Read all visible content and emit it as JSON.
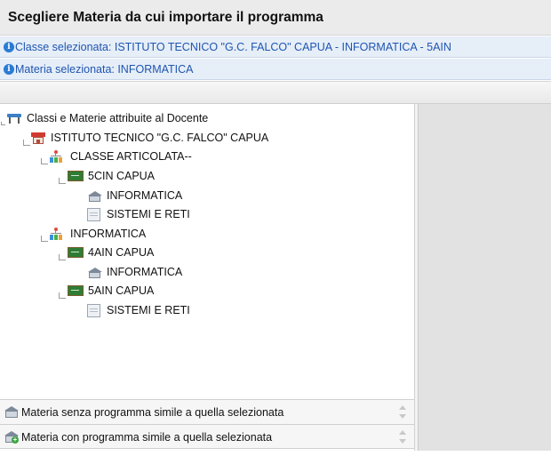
{
  "header": {
    "title": "Scegliere Materia da cui importare il programma"
  },
  "info": {
    "classe": "Classe selezionata: ISTITUTO TECNICO \"G.C. FALCO\" CAPUA - INFORMATICA - 5AIN",
    "materia": "Materia selezionata: INFORMATICA"
  },
  "tree": {
    "root": "Classi e Materie attribuite al Docente",
    "school": "ISTITUTO TECNICO \"G.C. FALCO\" CAPUA",
    "group1": "CLASSE ARTICOLATA--",
    "class1": "5CIN CAPUA",
    "class1_sub1": "INFORMATICA",
    "class1_sub2": "SISTEMI E RETI",
    "group2": "INFORMATICA",
    "class2": "4AIN CAPUA",
    "class2_sub1": "INFORMATICA",
    "class3": "5AIN CAPUA",
    "class3_sub1": "SISTEMI E RETI"
  },
  "legend": {
    "without": "Materia senza programma simile a quella selezionata",
    "with": "Materia con programma simile a quella selezionata"
  },
  "colors": {
    "info_text": "#1f55b0",
    "info_icon": "#2a7bd4",
    "right_panel": "#e2e2e2"
  }
}
